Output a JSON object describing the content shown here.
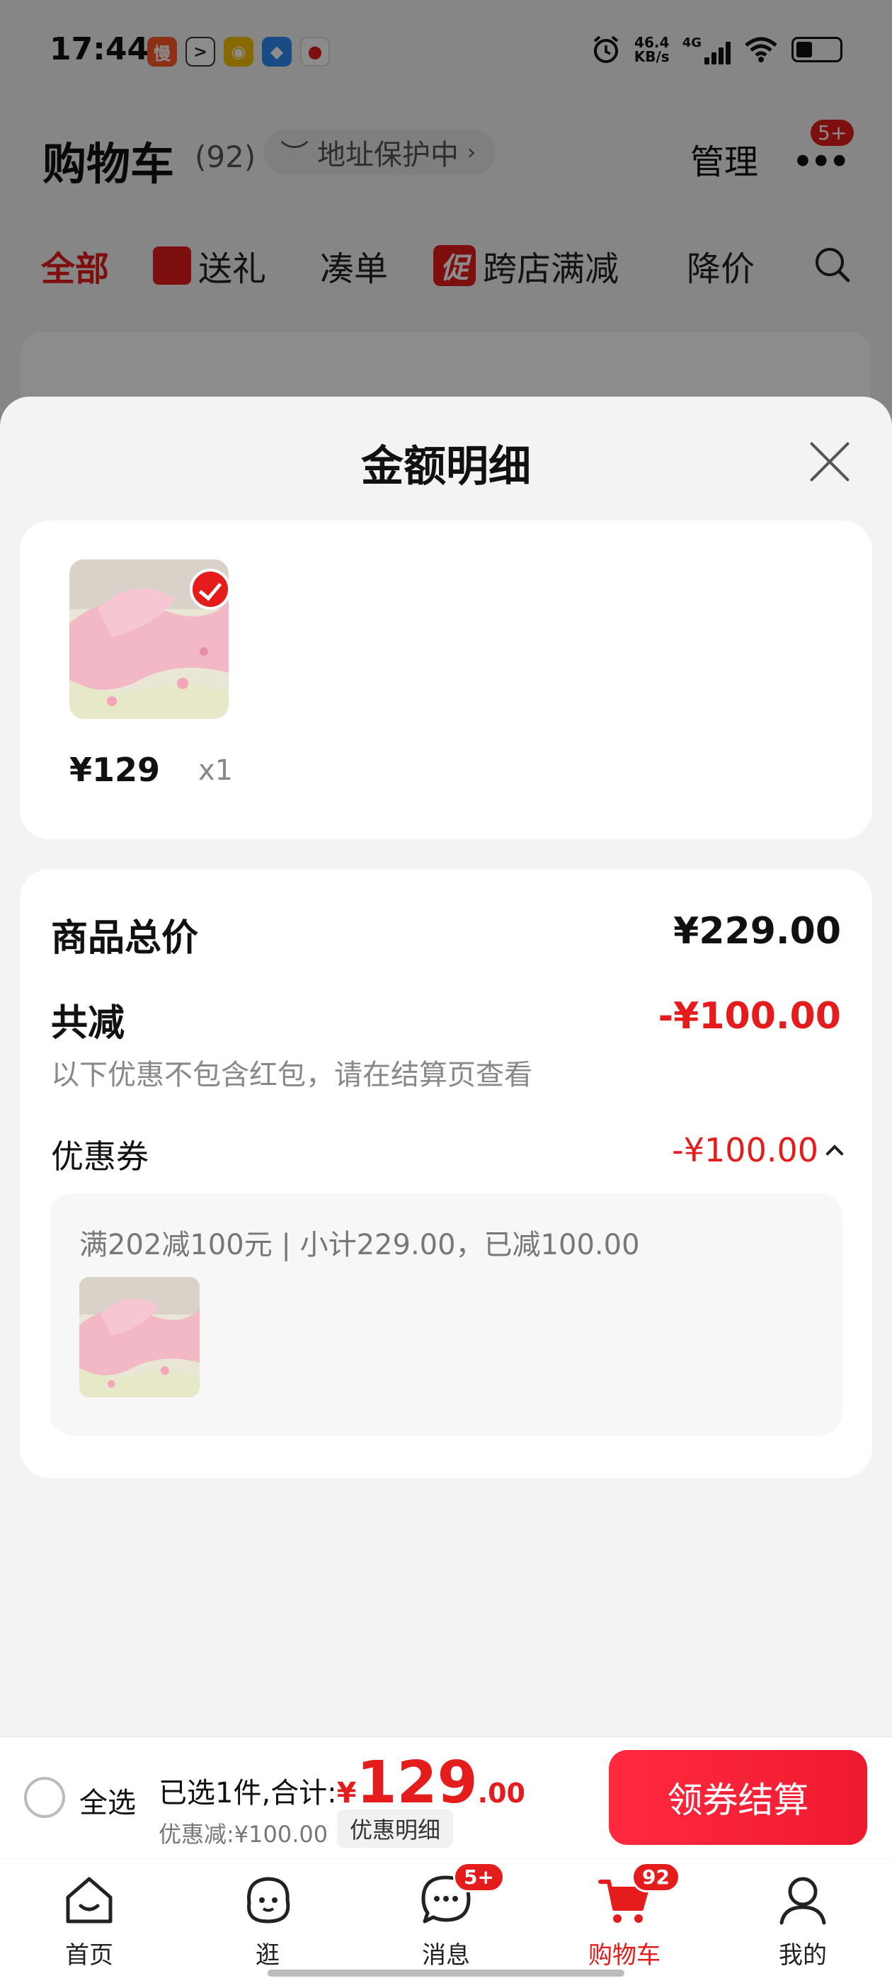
{
  "status_bar": {
    "time": "17:44",
    "net_speed_value": "46.4",
    "net_speed_unit": "KB/s",
    "network": "4G"
  },
  "header": {
    "title": "购物车",
    "count": "(92)",
    "address_protect": "地址保护中",
    "manage": "管理",
    "more_badge": "5+"
  },
  "tabs": [
    {
      "label": "全部",
      "active": true
    },
    {
      "label": "送礼"
    },
    {
      "label": "凑单"
    },
    {
      "label": "跨店满减",
      "tag": "促"
    },
    {
      "label": "降价"
    }
  ],
  "sheet": {
    "title": "金额明细",
    "items": [
      {
        "price": "¥129",
        "qty": "x1"
      }
    ],
    "total_label": "商品总价",
    "total_value": "¥229.00",
    "reduce_label": "共减",
    "reduce_value": "-¥100.00",
    "reduce_note": "以下优惠不包含红包，请在结算页查看",
    "coupon_label": "优惠券",
    "coupon_value": "-¥100.00",
    "coupon_desc": "满202减100元 | 小计229.00，已减100.00"
  },
  "checkout": {
    "select_all": "全选",
    "selected_text": "已选1件,合计:",
    "currency": "¥",
    "total_int": "129",
    "total_dec": ".00",
    "discount_text": "优惠减:¥100.00",
    "detail_chip": "优惠明细",
    "button": "领券结算"
  },
  "bottom_nav": [
    {
      "label": "首页"
    },
    {
      "label": "逛"
    },
    {
      "label": "消息",
      "badge": "5+"
    },
    {
      "label": "购物车",
      "badge": "92",
      "active": true
    },
    {
      "label": "我的"
    }
  ],
  "colors": {
    "accent": "#e41c1c",
    "checkout_gradient_start": "#ff2a3f",
    "checkout_gradient_end": "#ee1a2f"
  }
}
